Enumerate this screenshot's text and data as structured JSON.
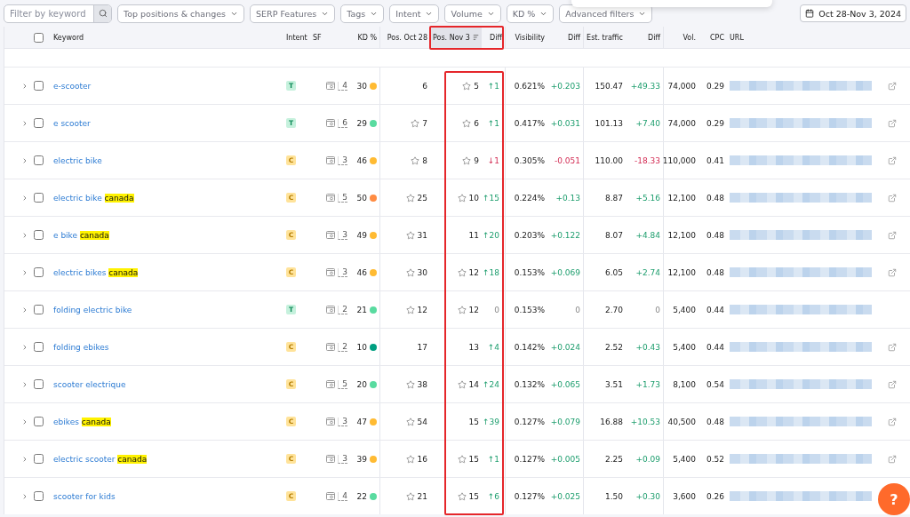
{
  "filters": {
    "search": {
      "placeholder": "Filter by keyword"
    },
    "dropdowns": [
      "Top positions & changes",
      "SERP Features",
      "Tags",
      "Intent",
      "Volume",
      "KD %",
      "Advanced filters"
    ],
    "date_range": "Oct 28-Nov 3, 2024"
  },
  "table": {
    "select_all_checked": false,
    "columns": [
      {
        "label": "Keyword",
        "sorted": false
      },
      {
        "label": "Intent",
        "sorted": false
      },
      {
        "label": "SF",
        "sorted": false
      },
      {
        "label": "KD %",
        "sorted": false
      },
      {
        "label": "Pos. Oct 28",
        "sorted": false
      },
      {
        "label": "Pos. Nov 3",
        "sorted": true
      },
      {
        "label": "Diff",
        "sorted": false
      },
      {
        "label": "Visibility",
        "sorted": false
      },
      {
        "label": "Diff",
        "sorted": false
      },
      {
        "label": "Est. traffic",
        "sorted": false
      },
      {
        "label": "Diff",
        "sorted": false
      },
      {
        "label": "Vol.",
        "sorted": false
      },
      {
        "label": "CPC",
        "sorted": false
      },
      {
        "label": "URL",
        "sorted": false
      }
    ],
    "rows": [
      {
        "keyword": "e-scooter",
        "intent": {
          "label": "T",
          "kind": "transactional"
        },
        "sf": "4",
        "kd": "30",
        "color": "#ffbb33",
        "pos_prev": "6",
        "prev_star": false,
        "pos_now": "5",
        "now_star": true,
        "diff": {
          "text": "↑1",
          "kind": "up"
        },
        "visibility": "0.621%",
        "vis_diff": {
          "text": "+0.203",
          "kind": "up"
        },
        "traffic": "150.47",
        "traffic_diff": {
          "text": "+49.33",
          "kind": "up"
        },
        "volume": "74,000",
        "cpc": "0.29",
        "link_icon": true,
        "checked": false
      },
      {
        "keyword": "e scooter",
        "intent": {
          "label": "T",
          "kind": "transactional"
        },
        "sf": "6",
        "kd": "29",
        "color": "#59dba0",
        "pos_prev": "7",
        "prev_star": true,
        "pos_now": "6",
        "now_star": true,
        "diff": {
          "text": "↑1",
          "kind": "up"
        },
        "visibility": "0.417%",
        "vis_diff": {
          "text": "+0.031",
          "kind": "up"
        },
        "traffic": "101.13",
        "traffic_diff": {
          "text": "+7.40",
          "kind": "up"
        },
        "volume": "74,000",
        "cpc": "0.29",
        "link_icon": true,
        "checked": false
      },
      {
        "keyword": "electric bike",
        "intent": {
          "label": "C",
          "kind": "commercial"
        },
        "sf": "3",
        "kd": "46",
        "color": "#ffbb33",
        "pos_prev": "8",
        "prev_star": true,
        "pos_now": "9",
        "now_star": true,
        "diff": {
          "text": "↓1",
          "kind": "down"
        },
        "visibility": "0.305%",
        "vis_diff": {
          "text": "-0.051",
          "kind": "down"
        },
        "traffic": "110.00",
        "traffic_diff": {
          "text": "-18.33",
          "kind": "down"
        },
        "volume": "110,000",
        "cpc": "0.41",
        "link_icon": true,
        "checked": false
      },
      {
        "keyword": "electric bike **canada**",
        "intent": {
          "label": "C",
          "kind": "commercial"
        },
        "sf": "5",
        "kd": "50",
        "color": "#ff8c43",
        "pos_prev": "25",
        "prev_star": true,
        "pos_now": "10",
        "now_star": true,
        "diff": {
          "text": "↑15",
          "kind": "up"
        },
        "visibility": "0.224%",
        "vis_diff": {
          "text": "+0.13",
          "kind": "up"
        },
        "traffic": "8.87",
        "traffic_diff": {
          "text": "+5.16",
          "kind": "up"
        },
        "volume": "12,100",
        "cpc": "0.48",
        "link_icon": true,
        "checked": false
      },
      {
        "keyword": "e bike **canada**",
        "intent": {
          "label": "C",
          "kind": "commercial"
        },
        "sf": "3",
        "kd": "49",
        "color": "#ffbb33",
        "pos_prev": "31",
        "prev_star": true,
        "pos_now": "11",
        "now_star": false,
        "diff": {
          "text": "↑20",
          "kind": "up"
        },
        "visibility": "0.203%",
        "vis_diff": {
          "text": "+0.122",
          "kind": "up"
        },
        "traffic": "8.07",
        "traffic_diff": {
          "text": "+4.84",
          "kind": "up"
        },
        "volume": "12,100",
        "cpc": "0.48",
        "link_icon": true,
        "checked": false
      },
      {
        "keyword": "electric bikes **canada**",
        "intent": {
          "label": "C",
          "kind": "commercial"
        },
        "sf": "3",
        "kd": "46",
        "color": "#ffbb33",
        "pos_prev": "30",
        "prev_star": true,
        "pos_now": "12",
        "now_star": true,
        "diff": {
          "text": "↑18",
          "kind": "up"
        },
        "visibility": "0.153%",
        "vis_diff": {
          "text": "+0.069",
          "kind": "up"
        },
        "traffic": "6.05",
        "traffic_diff": {
          "text": "+2.74",
          "kind": "up"
        },
        "volume": "12,100",
        "cpc": "0.48",
        "link_icon": true,
        "checked": false
      },
      {
        "keyword": "folding electric bike",
        "intent": {
          "label": "T",
          "kind": "transactional"
        },
        "sf": "2",
        "kd": "21",
        "color": "#59dba0",
        "pos_prev": "12",
        "prev_star": true,
        "pos_now": "12",
        "now_star": true,
        "diff": {
          "text": "0",
          "kind": "flat"
        },
        "visibility": "0.153%",
        "vis_diff": {
          "text": "0",
          "kind": "flat"
        },
        "traffic": "2.70",
        "traffic_diff": {
          "text": "0",
          "kind": "flat"
        },
        "volume": "5,400",
        "cpc": "0.44",
        "link_icon": false,
        "checked": false
      },
      {
        "keyword": "folding ebikes",
        "intent": {
          "label": "C",
          "kind": "commercial"
        },
        "sf": "2",
        "kd": "10",
        "color": "#009f81",
        "pos_prev": "17",
        "prev_star": false,
        "pos_now": "13",
        "now_star": false,
        "diff": {
          "text": "↑4",
          "kind": "up"
        },
        "visibility": "0.142%",
        "vis_diff": {
          "text": "+0.024",
          "kind": "up"
        },
        "traffic": "2.52",
        "traffic_diff": {
          "text": "+0.43",
          "kind": "up"
        },
        "volume": "5,400",
        "cpc": "0.44",
        "link_icon": true,
        "checked": false
      },
      {
        "keyword": "scooter electrique",
        "intent": {
          "label": "C",
          "kind": "commercial"
        },
        "sf": "5",
        "kd": "20",
        "color": "#59dba0",
        "pos_prev": "38",
        "prev_star": true,
        "pos_now": "14",
        "now_star": true,
        "diff": {
          "text": "↑24",
          "kind": "up"
        },
        "visibility": "0.132%",
        "vis_diff": {
          "text": "+0.065",
          "kind": "up"
        },
        "traffic": "3.51",
        "traffic_diff": {
          "text": "+1.73",
          "kind": "up"
        },
        "volume": "8,100",
        "cpc": "0.54",
        "link_icon": true,
        "checked": false
      },
      {
        "keyword": "ebikes **canada**",
        "intent": {
          "label": "C",
          "kind": "commercial"
        },
        "sf": "3",
        "kd": "47",
        "color": "#ffbb33",
        "pos_prev": "54",
        "prev_star": true,
        "pos_now": "15",
        "now_star": false,
        "diff": {
          "text": "↑39",
          "kind": "up"
        },
        "visibility": "0.127%",
        "vis_diff": {
          "text": "+0.079",
          "kind": "up"
        },
        "traffic": "16.88",
        "traffic_diff": {
          "text": "+10.53",
          "kind": "up"
        },
        "volume": "40,500",
        "cpc": "0.48",
        "link_icon": true,
        "checked": false
      },
      {
        "keyword": "electric scooter **canada**",
        "intent": {
          "label": "C",
          "kind": "commercial"
        },
        "sf": "3",
        "kd": "39",
        "color": "#ffbb33",
        "pos_prev": "16",
        "prev_star": true,
        "pos_now": "15",
        "now_star": true,
        "diff": {
          "text": "↑1",
          "kind": "up"
        },
        "visibility": "0.127%",
        "vis_diff": {
          "text": "+0.005",
          "kind": "up"
        },
        "traffic": "2.25",
        "traffic_diff": {
          "text": "+0.09",
          "kind": "up"
        },
        "volume": "5,400",
        "cpc": "0.52",
        "link_icon": true,
        "checked": false
      },
      {
        "keyword": "scooter for kids",
        "intent": {
          "label": "C",
          "kind": "commercial"
        },
        "sf": "4",
        "kd": "22",
        "color": "#59dba0",
        "pos_prev": "21",
        "prev_star": true,
        "pos_now": "15",
        "now_star": true,
        "diff": {
          "text": "↑6",
          "kind": "up"
        },
        "visibility": "0.127%",
        "vis_diff": {
          "text": "+0.025",
          "kind": "up"
        },
        "traffic": "1.50",
        "traffic_diff": {
          "text": "+0.30",
          "kind": "up"
        },
        "volume": "3,600",
        "cpc": "0.26",
        "link_icon": false,
        "checked": false
      }
    ]
  },
  "help_button": "?"
}
